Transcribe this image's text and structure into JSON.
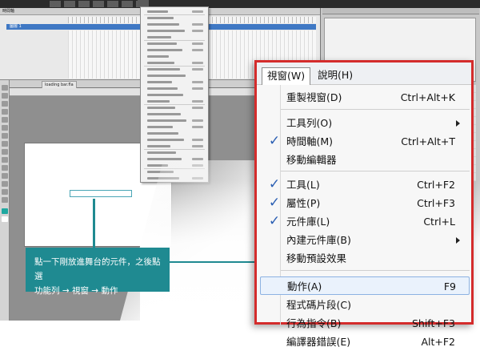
{
  "background": {
    "timeline_title": "時間軸",
    "layer_name": "圖層 1",
    "stage_tab_label": "loading bar.fla",
    "component_pct": "%"
  },
  "zoom_menu": {
    "menubar": {
      "view": "視窗(W)",
      "help": "說明(H)"
    },
    "items": [
      {
        "label": "重製視窗(D)",
        "shortcut": "Ctrl+Alt+K",
        "checked": false,
        "submenu": false
      },
      {
        "label": "工具列(O)",
        "shortcut": "",
        "checked": false,
        "submenu": true
      },
      {
        "label": "時間軸(M)",
        "shortcut": "Ctrl+Alt+T",
        "checked": true,
        "submenu": false
      },
      {
        "label": "移動編輯器",
        "shortcut": "",
        "checked": false,
        "submenu": false
      },
      {
        "label": "工具(L)",
        "shortcut": "Ctrl+F2",
        "checked": true,
        "submenu": false
      },
      {
        "label": "屬性(P)",
        "shortcut": "Ctrl+F3",
        "checked": true,
        "submenu": false
      },
      {
        "label": "元件庫(L)",
        "shortcut": "Ctrl+L",
        "checked": true,
        "submenu": false
      },
      {
        "label": "內建元件庫(B)",
        "shortcut": "",
        "checked": false,
        "submenu": true
      },
      {
        "label": "移動預設效果",
        "shortcut": "",
        "checked": false,
        "submenu": false
      },
      {
        "label": "動作(A)",
        "shortcut": "F9",
        "checked": false,
        "submenu": false,
        "highlighted": true
      },
      {
        "label": "程式碼片段(C)",
        "shortcut": "",
        "checked": false,
        "submenu": false
      },
      {
        "label": "行為指令(B)",
        "shortcut": "Shift+F3",
        "checked": false,
        "submenu": false
      },
      {
        "label": "編譯器錯誤(E)",
        "shortcut": "Alt+F2",
        "checked": false,
        "submenu": false
      }
    ]
  },
  "callout": {
    "line1": "點一下剛放進舞台的元件，之後點選",
    "line2": "功能列 → 視窗 → 動作"
  },
  "colors": {
    "accent": "#1f8a91",
    "menu_border": "#d42c2c",
    "check": "#2b5fb3"
  }
}
